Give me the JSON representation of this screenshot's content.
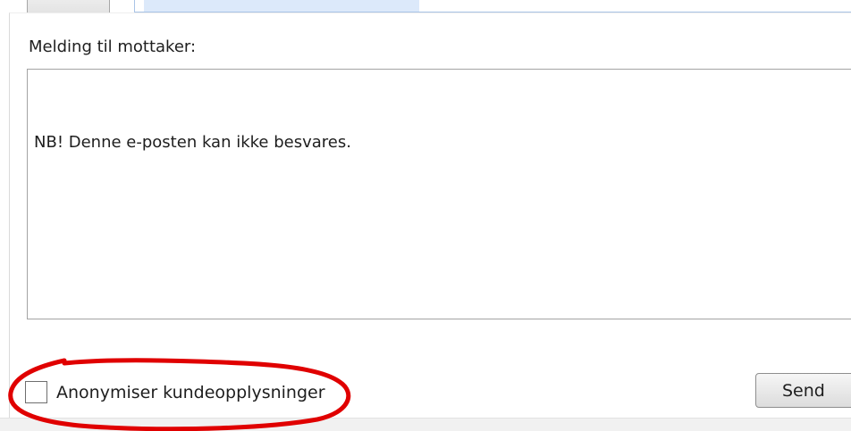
{
  "message": {
    "label": "Melding til mottaker:",
    "text": "NB! Denne e-posten kan ikke besvares."
  },
  "options": {
    "anonymize_label": "Anonymiser kundeopplysninger",
    "anonymize_checked": false
  },
  "actions": {
    "send_label": "Send"
  },
  "colors": {
    "annotation": "#e00000",
    "input_border": "#a3a3a3",
    "selection": "#dce9fa"
  }
}
